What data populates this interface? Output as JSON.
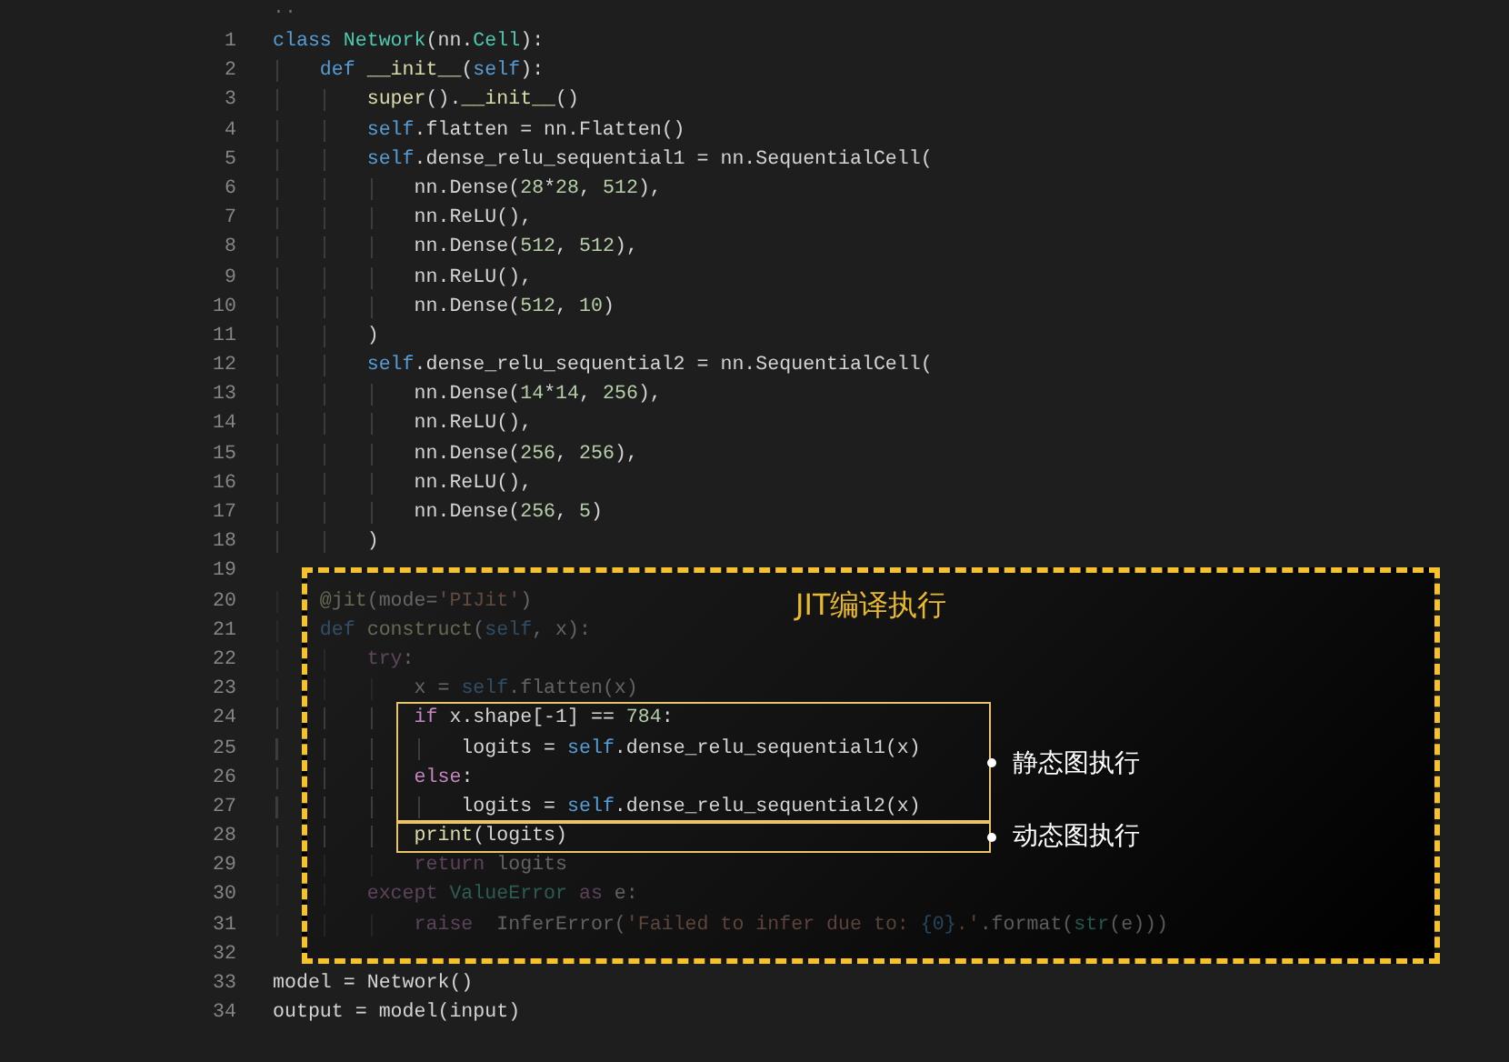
{
  "top_fragment": "..",
  "code": [
    {
      "kind": "line",
      "number": "1",
      "dimmed": false,
      "tokens": [
        {
          "kind": "keyword",
          "text": "class "
        },
        {
          "kind": "type",
          "text": "Network"
        },
        {
          "kind": "plain",
          "text": "(nn."
        },
        {
          "kind": "type",
          "text": "Cell"
        },
        {
          "kind": "plain",
          "text": "):"
        }
      ]
    },
    {
      "kind": "line",
      "number": "2",
      "dimmed": false,
      "tokens": [
        {
          "kind": "keyword",
          "text": "    def "
        },
        {
          "kind": "func",
          "text": "__init__"
        },
        {
          "kind": "plain",
          "text": "("
        },
        {
          "kind": "keyword",
          "text": "self"
        },
        {
          "kind": "plain",
          "text": "):"
        }
      ]
    },
    {
      "kind": "line",
      "number": "3",
      "dimmed": false,
      "tokens": [
        {
          "kind": "func",
          "text": "        super"
        },
        {
          "kind": "plain",
          "text": "()."
        },
        {
          "kind": "func",
          "text": "__init__"
        },
        {
          "kind": "plain",
          "text": "()"
        }
      ]
    },
    {
      "kind": "line",
      "number": "4",
      "dimmed": false,
      "tokens": [
        {
          "kind": "keyword",
          "text": "        self"
        },
        {
          "kind": "plain",
          "text": ".flatten = nn.Flatten()"
        }
      ]
    },
    {
      "kind": "line",
      "number": "5",
      "dimmed": false,
      "tokens": [
        {
          "kind": "keyword",
          "text": "        self"
        },
        {
          "kind": "plain",
          "text": ".dense_relu_sequential1 = nn.SequentialCell("
        }
      ]
    },
    {
      "kind": "line",
      "number": "6",
      "dimmed": false,
      "tokens": [
        {
          "kind": "plain",
          "text": "            nn.Dense("
        },
        {
          "kind": "number",
          "text": "28"
        },
        {
          "kind": "plain",
          "text": "*"
        },
        {
          "kind": "number",
          "text": "28"
        },
        {
          "kind": "plain",
          "text": ", "
        },
        {
          "kind": "number",
          "text": "512"
        },
        {
          "kind": "plain",
          "text": "),"
        }
      ]
    },
    {
      "kind": "line",
      "number": "7",
      "dimmed": false,
      "tokens": [
        {
          "kind": "plain",
          "text": "            nn.ReLU(),"
        }
      ]
    },
    {
      "kind": "line",
      "number": "8",
      "dimmed": false,
      "tokens": [
        {
          "kind": "plain",
          "text": "            nn.Dense("
        },
        {
          "kind": "number",
          "text": "512"
        },
        {
          "kind": "plain",
          "text": ", "
        },
        {
          "kind": "number",
          "text": "512"
        },
        {
          "kind": "plain",
          "text": "),"
        }
      ]
    },
    {
      "kind": "line",
      "number": "9",
      "dimmed": false,
      "tokens": [
        {
          "kind": "plain",
          "text": "            nn.ReLU(),"
        }
      ]
    },
    {
      "kind": "line",
      "number": "10",
      "dimmed": false,
      "tokens": [
        {
          "kind": "plain",
          "text": "            nn.Dense("
        },
        {
          "kind": "number",
          "text": "512"
        },
        {
          "kind": "plain",
          "text": ", "
        },
        {
          "kind": "number",
          "text": "10"
        },
        {
          "kind": "plain",
          "text": ")"
        }
      ]
    },
    {
      "kind": "line",
      "number": "11",
      "dimmed": false,
      "tokens": [
        {
          "kind": "plain",
          "text": "        )"
        }
      ]
    },
    {
      "kind": "line",
      "number": "12",
      "dimmed": false,
      "tokens": [
        {
          "kind": "keyword",
          "text": "        self"
        },
        {
          "kind": "plain",
          "text": ".dense_relu_sequential2 = nn.SequentialCell("
        }
      ]
    },
    {
      "kind": "line",
      "number": "13",
      "dimmed": false,
      "tokens": [
        {
          "kind": "plain",
          "text": "            nn.Dense("
        },
        {
          "kind": "number",
          "text": "14"
        },
        {
          "kind": "plain",
          "text": "*"
        },
        {
          "kind": "number",
          "text": "14"
        },
        {
          "kind": "plain",
          "text": ", "
        },
        {
          "kind": "number",
          "text": "256"
        },
        {
          "kind": "plain",
          "text": "),"
        }
      ]
    },
    {
      "kind": "line",
      "number": "14",
      "dimmed": false,
      "tokens": [
        {
          "kind": "plain",
          "text": "            nn.ReLU(),"
        }
      ]
    },
    {
      "kind": "line",
      "number": "15",
      "dimmed": false,
      "tokens": [
        {
          "kind": "plain",
          "text": "            nn.Dense("
        },
        {
          "kind": "number",
          "text": "256"
        },
        {
          "kind": "plain",
          "text": ", "
        },
        {
          "kind": "number",
          "text": "256"
        },
        {
          "kind": "plain",
          "text": "),"
        }
      ]
    },
    {
      "kind": "line",
      "number": "16",
      "dimmed": false,
      "tokens": [
        {
          "kind": "plain",
          "text": "            nn.ReLU(),"
        }
      ]
    },
    {
      "kind": "line",
      "number": "17",
      "dimmed": false,
      "tokens": [
        {
          "kind": "plain",
          "text": "            nn.Dense("
        },
        {
          "kind": "number",
          "text": "256"
        },
        {
          "kind": "plain",
          "text": ", "
        },
        {
          "kind": "number",
          "text": "5"
        },
        {
          "kind": "plain",
          "text": ")"
        }
      ]
    },
    {
      "kind": "line",
      "number": "18",
      "dimmed": false,
      "tokens": [
        {
          "kind": "plain",
          "text": "        )"
        }
      ]
    },
    {
      "kind": "line",
      "number": "19"
    },
    {
      "kind": "panel",
      "title": "JIT编译执行",
      "items": [
        {
          "kind": "line",
          "number": "20",
          "dimmed": true,
          "tokens": [
            {
              "kind": "decorator",
              "text": "    @jit"
            },
            {
              "kind": "plain",
              "text": "(mode="
            },
            {
              "kind": "string",
              "text": "'PIJit'"
            },
            {
              "kind": "plain",
              "text": ")"
            }
          ]
        },
        {
          "kind": "line",
          "number": "21",
          "dimmed": true,
          "tokens": [
            {
              "kind": "keyword",
              "text": "    def "
            },
            {
              "kind": "func",
              "text": "construct"
            },
            {
              "kind": "plain",
              "text": "("
            },
            {
              "kind": "keyword",
              "text": "self"
            },
            {
              "kind": "plain",
              "text": ", x):"
            }
          ]
        },
        {
          "kind": "line",
          "number": "22",
          "dimmed": true,
          "tokens": [
            {
              "kind": "control",
              "text": "        try"
            },
            {
              "kind": "plain",
              "text": ":"
            }
          ]
        },
        {
          "kind": "line",
          "number": "23",
          "dimmed": true,
          "tokens": [
            {
              "kind": "plain",
              "text": "            x = "
            },
            {
              "kind": "keyword",
              "text": "self"
            },
            {
              "kind": "plain",
              "text": ".flatten(x)"
            }
          ]
        },
        {
          "kind": "frame",
          "label": "静态图执行",
          "items": [
            {
              "kind": "line",
              "number": "24",
              "dimmed": false,
              "tokens": [
                {
                  "kind": "control",
                  "text": "            if "
                },
                {
                  "kind": "plain",
                  "text": "x.shape[-1] == "
                },
                {
                  "kind": "number",
                  "text": "784"
                },
                {
                  "kind": "plain",
                  "text": ":"
                }
              ]
            },
            {
              "kind": "line",
              "number": "25",
              "dimmed": false,
              "tokens": [
                {
                  "kind": "plain",
                  "text": "                logits = "
                },
                {
                  "kind": "keyword",
                  "text": "self"
                },
                {
                  "kind": "plain",
                  "text": ".dense_relu_sequential1(x)"
                }
              ]
            },
            {
              "kind": "line",
              "number": "26",
              "dimmed": false,
              "tokens": [
                {
                  "kind": "control",
                  "text": "            else"
                },
                {
                  "kind": "plain",
                  "text": ":"
                }
              ]
            },
            {
              "kind": "line",
              "number": "27",
              "dimmed": false,
              "tokens": [
                {
                  "kind": "plain",
                  "text": "                logits = "
                },
                {
                  "kind": "keyword",
                  "text": "self"
                },
                {
                  "kind": "plain",
                  "text": ".dense_relu_sequential2(x)"
                }
              ]
            }
          ]
        },
        {
          "kind": "frame",
          "label": "动态图执行",
          "items": [
            {
              "kind": "line",
              "number": "28",
              "dimmed": false,
              "tokens": [
                {
                  "kind": "func",
                  "text": "            print"
                },
                {
                  "kind": "plain",
                  "text": "(logits)"
                }
              ]
            }
          ]
        },
        {
          "kind": "line",
          "number": "29",
          "dimmed": true,
          "tokens": [
            {
              "kind": "control",
              "text": "            return "
            },
            {
              "kind": "plain",
              "text": "logits"
            }
          ]
        },
        {
          "kind": "line",
          "number": "30",
          "dimmed": true,
          "tokens": [
            {
              "kind": "control",
              "text": "        except "
            },
            {
              "kind": "type",
              "text": "ValueError"
            },
            {
              "kind": "control",
              "text": " as "
            },
            {
              "kind": "plain",
              "text": "e:"
            }
          ]
        },
        {
          "kind": "line",
          "number": "31",
          "dimmed": true,
          "tokens": [
            {
              "kind": "control",
              "text": "            raise"
            },
            {
              "kind": "plain",
              "text": "  InferError("
            },
            {
              "kind": "string",
              "text": "'Failed to infer due to: "
            },
            {
              "kind": "keyword",
              "text": "{0}"
            },
            {
              "kind": "string",
              "text": ".'"
            },
            {
              "kind": "plain",
              "text": ".format("
            },
            {
              "kind": "type",
              "text": "str"
            },
            {
              "kind": "plain",
              "text": "(e)))"
            }
          ]
        }
      ]
    },
    {
      "kind": "line",
      "number": "32"
    },
    {
      "kind": "line",
      "number": "33",
      "dimmed": false,
      "tokens": [
        {
          "kind": "plain",
          "text": "model = Network()"
        }
      ]
    },
    {
      "kind": "line",
      "number": "34",
      "dimmed": false,
      "tokens": [
        {
          "kind": "plain",
          "text": "output = model(input)"
        }
      ]
    }
  ]
}
